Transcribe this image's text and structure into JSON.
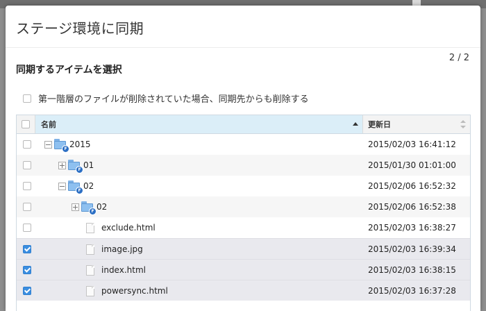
{
  "dialog": {
    "title": "ステージ環境に同期",
    "step": "2 / 2",
    "section_heading": "同期するアイテムを選択",
    "delete_option_label": "第一階層のファイルが削除されていた場合、同期先からも削除する",
    "delete_option_checked": false
  },
  "grid": {
    "columns": {
      "name": "名前",
      "modified": "更新日"
    },
    "sort": {
      "column": "name",
      "direction": "ascending"
    },
    "rows": [
      {
        "name": "2015",
        "type": "folder",
        "depth": 0,
        "expander": "expanded",
        "modified": "2015/02/03 16:41:12",
        "checked": false
      },
      {
        "name": "01",
        "type": "folder",
        "depth": 1,
        "expander": "collapsed",
        "modified": "2015/01/30 01:01:00",
        "checked": false
      },
      {
        "name": "02",
        "type": "folder",
        "depth": 1,
        "expander": "expanded",
        "modified": "2015/02/06 16:52:32",
        "checked": false
      },
      {
        "name": "02",
        "type": "folder",
        "depth": 2,
        "expander": "collapsed",
        "modified": "2015/02/06 16:52:38",
        "checked": false
      },
      {
        "name": "exclude.html",
        "type": "file",
        "depth": 3,
        "expander": "none",
        "modified": "2015/02/03 16:38:27",
        "checked": false
      },
      {
        "name": "image.jpg",
        "type": "file",
        "depth": 3,
        "expander": "none",
        "modified": "2015/02/03 16:39:34",
        "checked": true
      },
      {
        "name": "index.html",
        "type": "file",
        "depth": 3,
        "expander": "none",
        "modified": "2015/02/03 16:38:15",
        "checked": true
      },
      {
        "name": "powersync.html",
        "type": "file",
        "depth": 3,
        "expander": "none",
        "modified": "2015/02/03 16:37:28",
        "checked": true
      }
    ]
  },
  "icons": {
    "folder": "folder-icon",
    "folder_badge_letter": "F",
    "file": "file-icon",
    "checkbox_checked_color": "#3b8ee0",
    "header_sorted_bg": "#dbeef8"
  }
}
